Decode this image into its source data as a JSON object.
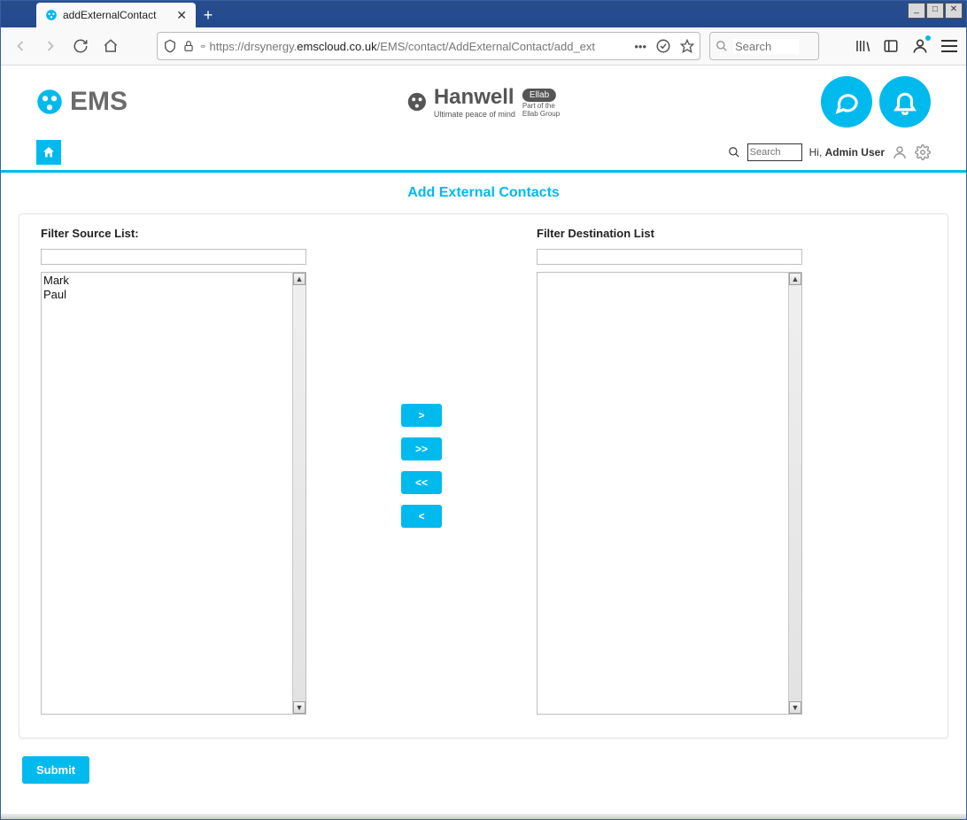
{
  "browser": {
    "tab_title": "addExternalContact",
    "url_prefix": "https://drsynergy.",
    "url_host": "emscloud.co.uk",
    "url_path": "/EMS/contact/AddExternalContact/add_ext",
    "search_placeholder": "Search",
    "new_tab_label": "+"
  },
  "app": {
    "logo_text": "EMS",
    "hanwell_text": "Hanwell",
    "hanwell_tagline": "Ultimate peace of mind",
    "ellab_badge": "Ellab",
    "ellab_sub1": "Part of the",
    "ellab_sub2": "Ellab Group",
    "search_placeholder": "Search",
    "greeting_prefix": "Hi,",
    "username": "Admin User",
    "page_title": "Add External Contacts"
  },
  "panel": {
    "source_label": "Filter Source List:",
    "dest_label": "Filter Destination List",
    "source_items": [
      "Mark",
      "Paul"
    ],
    "dest_items": [],
    "btn_right": ">",
    "btn_all_right": ">>",
    "btn_all_left": "<<",
    "btn_left": "<",
    "submit_label": "Submit"
  }
}
